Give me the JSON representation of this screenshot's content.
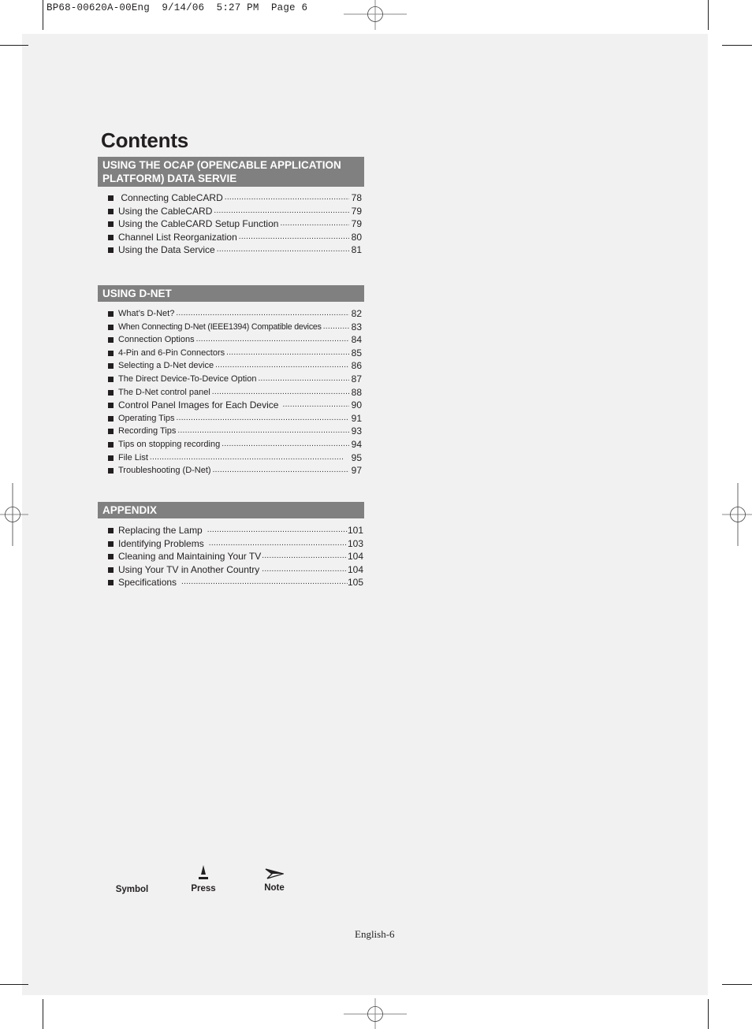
{
  "slug_line": "BP68-00620A-00Eng  9/14/06  5:27 PM  Page 6",
  "title": "Contents",
  "sections": [
    {
      "heading": "USING THE OCAP (OPENCABLE APPLICATION PLATFORM) DATA SERVIE",
      "items": [
        {
          "label": " Connecting CableCARD",
          "page": "78"
        },
        {
          "label": "Using the CableCARD",
          "page": "79"
        },
        {
          "label": "Using the CableCARD Setup Function",
          "page": "79"
        },
        {
          "label": "Channel List Reorganization",
          "page": "80"
        },
        {
          "label": "Using the Data Service",
          "page": "81"
        }
      ]
    },
    {
      "heading": "USING D-NET",
      "items": [
        {
          "label": "What’s D-Net?",
          "page": "82"
        },
        {
          "label": "When Connecting D-Net (IEEE1394) Compatible devices",
          "page": "83"
        },
        {
          "label": "Connection Options",
          "page": "84"
        },
        {
          "label": "4-Pin and 6-Pin Connectors",
          "page": "85"
        },
        {
          "label": "Selecting a D-Net device",
          "page": "86"
        },
        {
          "label": "The Direct Device-To-Device Option",
          "page": "87"
        },
        {
          "label": "The D-Net control panel",
          "page": "88"
        },
        {
          "label": "Control Panel Images for Each Device",
          "page": "90"
        },
        {
          "label": "Operating Tips",
          "page": "91"
        },
        {
          "label": "Recording Tips",
          "page": "93"
        },
        {
          "label": "Tips on stopping recording",
          "page": "94"
        },
        {
          "label": "File List",
          "page": "95"
        },
        {
          "label": "Troubleshooting (D-Net)",
          "page": "97"
        }
      ]
    },
    {
      "heading": "APPENDIX",
      "items": [
        {
          "label": "Replacing the Lamp",
          "page": "101"
        },
        {
          "label": "Identifying Problems",
          "page": "103"
        },
        {
          "label": "Cleaning and Maintaining Your TV",
          "page": "104"
        },
        {
          "label": "Using Your TV in Another Country",
          "page": "104"
        },
        {
          "label": "Specifications",
          "page": "105"
        }
      ]
    }
  ],
  "legend": {
    "symbol_label": "Symbol",
    "press_label": "Press",
    "note_label": "Note",
    "press_icon": "press-arrow-icon",
    "note_icon": "note-arrow-icon"
  },
  "footer": {
    "page_label": "English-6"
  },
  "colors": {
    "section_header_bg": "#808080",
    "page_bg": "#f1f1f1",
    "text": "#231f20"
  }
}
